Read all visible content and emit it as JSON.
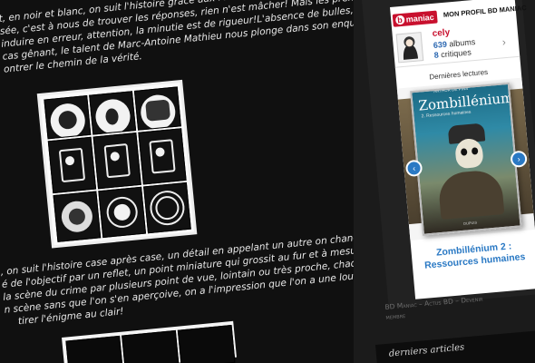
{
  "article": {
    "paragraph1": [
      "t, en noir et blanc, on suit l'histoire grâce aux reflets et détails de chaque",
      "sée, c'est à nous de trouver les réponses, rien n'est mâcher! Mais les premières",
      "induire en erreur, attention, la minutie est de rigueur!L'absence de bulles, de",
      "cas gênant, le talent de Marc-Antoine Mathieu nous plonge dans son enquête,",
      "ontrer le chemin de la vérité."
    ],
    "paragraph2": [
      ", on suit l'histoire case après case, un détail en appelant un autre on change de",
      "é de l'objectif par un reflet, un point miniature qui grossit au fur et à mesure",
      "la scène du crime par plusieurs point de vue, lointain ou très proche, chaque",
      "n scène sans que l'on s'en aperçoive, on a l'impression que l'on a une loupe sous",
      "tirer l'énigme au clair!"
    ]
  },
  "widget": {
    "logo": "bdmaniac",
    "logo_b": "b",
    "logo_rest": "maniac",
    "title": "MON PROFIL BD MANIAC",
    "user": "cely",
    "albums_count": "639",
    "albums_label": " albums",
    "critiques_count": "8",
    "critiques_label": " critiques",
    "next_chevron": "›",
    "lectures_heading": "Dernières lectures",
    "cover": {
      "author": "ARTHUR DE PINS",
      "title": "Zombillénium",
      "subtitle": "2. Ressources humaines",
      "publisher": "DUPUIS"
    },
    "prev_arrow": "‹",
    "next_arrow": "›",
    "book_title_line1": "Zombillénium 2 :",
    "book_title_line2": "Ressources humaines"
  },
  "footer": {
    "line1": "BD Maniac – Actus BD – Devenir",
    "line2": "membre"
  },
  "sidebar": {
    "articles_title": "derniers articles"
  },
  "colors": {
    "brand_red": "#c8102e",
    "link_blue": "#2a79c4",
    "background": "#121212"
  }
}
